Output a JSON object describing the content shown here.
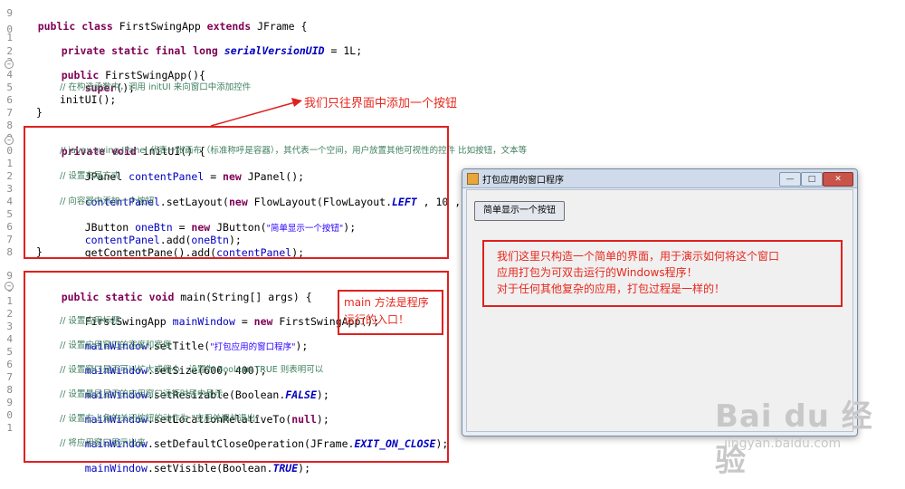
{
  "code": {
    "gutter": [
      "9",
      "0",
      "1",
      "2",
      "3",
      "4",
      "5",
      "6",
      "7",
      "8",
      "9",
      "0",
      "1",
      "2",
      "3",
      "4",
      "5",
      "6",
      "7",
      "8",
      "9",
      "0",
      "1",
      "2",
      "3",
      "4",
      "5",
      "6",
      "7",
      "8",
      "9",
      "0",
      "1"
    ],
    "line_class_decl": [
      "public",
      " ",
      "class",
      " FirstSwingApp ",
      "extends",
      " JFrame {"
    ],
    "line_serial": [
      "private",
      " ",
      "static",
      " ",
      "final",
      " ",
      "long",
      " ",
      "serialVersionUID",
      " = 1L;"
    ],
    "line_ctor": [
      "public",
      " FirstSwingApp(){"
    ],
    "line_super": [
      "super",
      "();"
    ],
    "line_ctor_comment": "// 在构造函数中，调用 initUI 来向窗口中添加控件",
    "line_inituicall": "initUI();",
    "line_close1": "}",
    "line_initui_decl": [
      "private",
      " ",
      "void",
      " initUI() {"
    ],
    "line_jpanel_comment": "// javax.swing.JPanel 代表一张画布（标准称呼是容器），其代表一个空间，用户放置其他可视性的控件 比如按钮，文本等",
    "line_jpanel": [
      "JPanel ",
      "contentPanel",
      " = ",
      "new",
      " JPanel();"
    ],
    "line_layout_comment": "// 设置布局方式",
    "line_setlayout": [
      "contentPanel",
      ".setLayout(",
      "new",
      " FlowLayout(FlowLayout.",
      "LEFT",
      " , 10 , 20));"
    ],
    "line_addbtn_comment": "// 向容器中添加一个按钮",
    "line_jbutton": [
      "JButton ",
      "oneBtn",
      " = ",
      "new",
      " JButton(",
      "\"简单显示一个按钮\"",
      ");"
    ],
    "line_addbtn": [
      "contentPanel",
      ".add(",
      "oneBtn",
      ");"
    ],
    "line_getcp": [
      "getContentPane().add(",
      "contentPanel",
      ");"
    ],
    "line_close2": "}",
    "line_main_decl": [
      "public",
      " ",
      "static",
      " ",
      "void",
      " main(String[] args) {"
    ],
    "line_mainwindow": [
      "FirstSwingApp ",
      "mainWindow",
      " = ",
      "new",
      " FirstSwingApp();"
    ],
    "line_title_comment": "// 设置应用标题",
    "line_settitle": [
      "mainWindow",
      ".setTitle(",
      "\"打包应用的窗口程序\"",
      ");"
    ],
    "line_size_comment": "// 设置应用窗口的宽度和宽度",
    "line_setsize": [
      "mainWindow",
      ".setSize(600, 400);"
    ],
    "line_resizable_comment": "// 设置窗口是否可以扩大或缩小，设置为 Boolean.TRUE 则表明可以",
    "line_setresizable": [
      "mainWindow",
      ".setResizable(Boolean.",
      "FALSE",
      ");"
    ],
    "line_location_comment": "// 设置最后显示的应用窗口运行时居中显示",
    "line_setlocation": [
      "mainWindow",
      ".setLocationRelativeTo(",
      "null",
      ");"
    ],
    "line_close_comment": "// 设置右上角的关闭按钮的动作为 \"应用关闭并退出\"",
    "line_setclose": [
      "mainWindow",
      ".setDefaultCloseOperation(JFrame.",
      "EXIT_ON_CLOSE",
      ");"
    ],
    "line_visible_comment": "// 将应用窗口显示出来",
    "line_setvisible": [
      "mainWindow",
      ".setVisible(Boolean.",
      "TRUE",
      ");"
    ]
  },
  "callouts": {
    "initui_note": "我们只往界面中添加一个按钮",
    "main_note_line1": "main 方法是程序",
    "main_note_line2": "运行的入口！"
  },
  "app_window": {
    "title": "打包应用的窗口程序",
    "button_label": "简单显示一个按钮",
    "minimize": "—",
    "maximize": "□",
    "close": "✕",
    "note_line1": "我们这里只构造一个简单的界面，用于演示如何将这个窗口",
    "note_line2": "应用打包为可双击运行的Windows程序！",
    "note_line3": "对于任何其他复杂的应用，打包过程是一样的！"
  },
  "colors": {
    "annotation_red": "#e8271d",
    "keyword": "#7f0055",
    "field": "#0000c0",
    "comment": "#3f7f5f",
    "string": "#2a00ff"
  },
  "watermark": {
    "logo": "Bai du 经验",
    "url": "jingyan.baidu.com"
  }
}
